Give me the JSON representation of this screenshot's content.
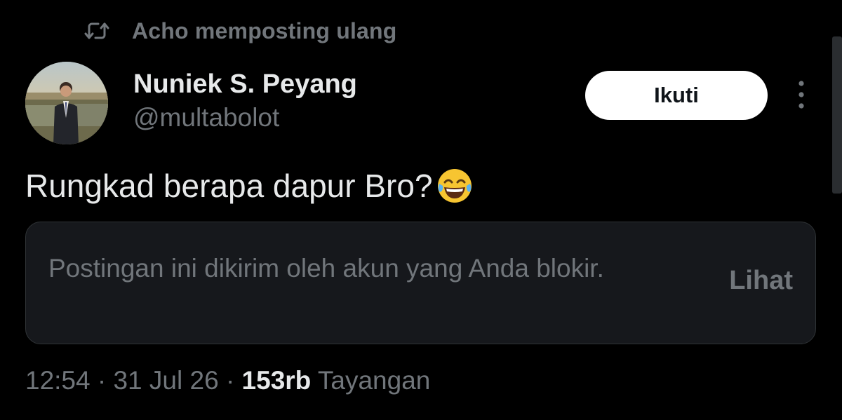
{
  "repost": {
    "icon": "repost-icon",
    "text": "Acho memposting ulang"
  },
  "author": {
    "avatar": "avatar",
    "name": "Nuniek S. Peyang",
    "handle": "@multabolot"
  },
  "actions": {
    "follow_label": "Ikuti",
    "more_icon": "more-vertical-icon"
  },
  "post": {
    "text": "Rungkad berapa dapur Bro?",
    "emoji": "😂"
  },
  "blocked_notice": {
    "text": "Postingan ini dikirim oleh akun yang Anda blokir.",
    "view_label": "Lihat"
  },
  "meta": {
    "time": "12:54",
    "separator": "·",
    "date": "31 Jul 26",
    "views_count": "153rb",
    "views_label": "Tayangan"
  },
  "colors": {
    "background": "#000000",
    "primary_text": "#e7e9ea",
    "secondary_text": "#71767b",
    "card_background": "#16181c",
    "button_background": "#ffffff"
  }
}
